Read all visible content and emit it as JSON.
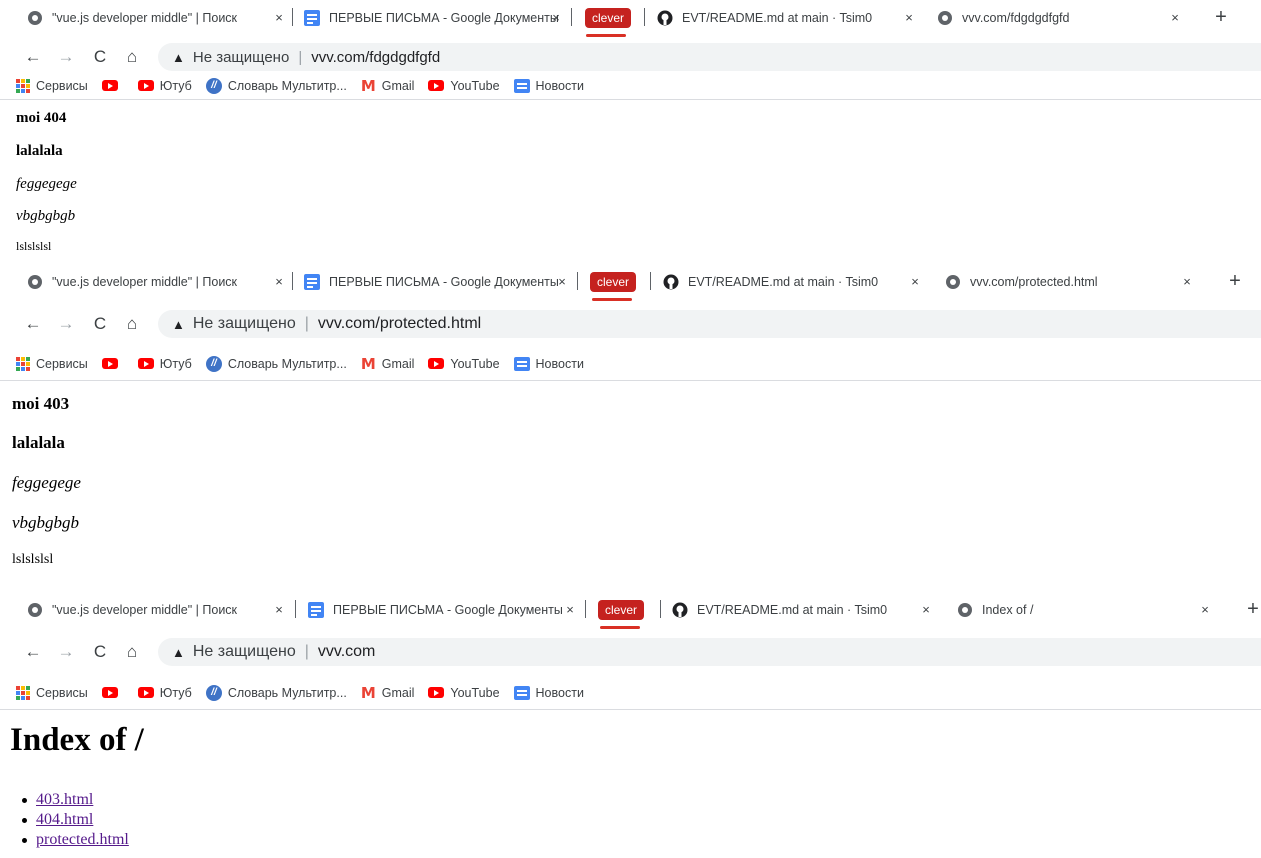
{
  "tabs": {
    "tab1": "\"vue.js developer middle\" | Поиск",
    "tab2": "ПЕРВЫЕ ПИСЬМА - Google Документы",
    "tab3_badge": "clever",
    "tab4": "EVT/README.md at main · Tsim0",
    "close": "×",
    "newtab": "+"
  },
  "toolbar": {
    "back": "←",
    "forward": "→",
    "reload": "C",
    "home": "⌂",
    "warning": "▲",
    "not_secure": "Не защищено",
    "separator": "|"
  },
  "bookmarks": {
    "services": "Сервисы",
    "youtube_ru": "Ютуб",
    "dictionary": "Словарь Мультитр...",
    "gmail": "Gmail",
    "youtube": "YouTube",
    "news": "Новости"
  },
  "windows": [
    {
      "active_tab": "vvv.com/fdgdgdfgfd",
      "url": "vvv.com/fdgdgdfgfd",
      "lines": [
        "moi 404",
        "lalalala",
        "feggegege",
        "vbgbgbgb",
        "lslslslsl"
      ]
    },
    {
      "active_tab": "vvv.com/protected.html",
      "url": "vvv.com/protected.html",
      "lines": [
        "moi 403",
        "lalalala",
        "feggegege",
        "vbgbgbgb",
        "lslslslsl"
      ]
    },
    {
      "active_tab": "Index of /",
      "url": "vvv.com",
      "heading": "Index of /",
      "links": [
        "403.html",
        "404.html",
        "protected.html"
      ]
    }
  ]
}
